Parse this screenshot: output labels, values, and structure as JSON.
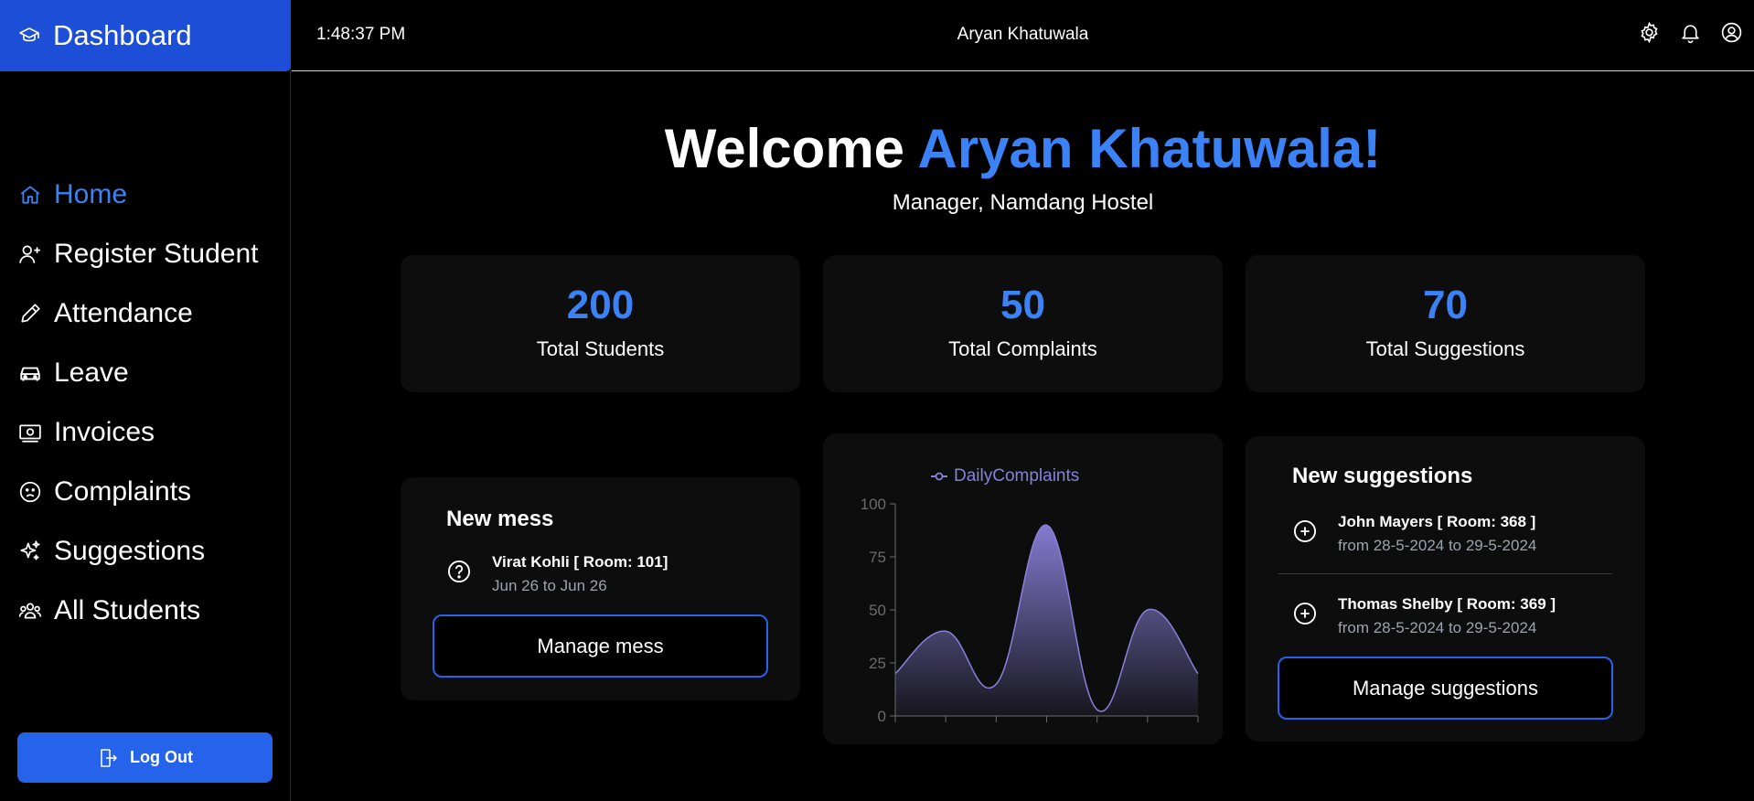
{
  "brand": {
    "title": "Dashboard"
  },
  "sidebar": {
    "items": [
      {
        "label": "Home",
        "icon": "home-icon",
        "active": true
      },
      {
        "label": "Register Student",
        "icon": "user-add-icon"
      },
      {
        "label": "Attendance",
        "icon": "pencil-icon"
      },
      {
        "label": "Leave",
        "icon": "car-icon"
      },
      {
        "label": "Invoices",
        "icon": "banknote-icon"
      },
      {
        "label": "Complaints",
        "icon": "sad-face-icon"
      },
      {
        "label": "Suggestions",
        "icon": "sparkles-icon"
      },
      {
        "label": "All Students",
        "icon": "users-icon"
      }
    ],
    "logout_label": "Log Out"
  },
  "topbar": {
    "time": "1:48:37 PM",
    "username": "Aryan Khatuwala",
    "icons": [
      "gear-icon",
      "bell-icon",
      "user-circle-icon"
    ]
  },
  "welcome": {
    "prefix": "Welcome ",
    "name": "Aryan Khatuwala!",
    "role": "Manager, Namdang Hostel"
  },
  "stats": [
    {
      "value": "200",
      "label": "Total Students"
    },
    {
      "value": "50",
      "label": "Total Complaints"
    },
    {
      "value": "70",
      "label": "Total Suggestions"
    }
  ],
  "mess": {
    "title": "New mess",
    "entries": [
      {
        "name": "Virat Kohli [ Room: 101]",
        "dates": "Jun 26 to Jun 26"
      }
    ],
    "button": "Manage mess"
  },
  "chart_data": {
    "type": "area",
    "series": [
      {
        "name": "DailyComplaints",
        "values": [
          20,
          40,
          15,
          90,
          3,
          50,
          20
        ]
      }
    ],
    "x": [
      0,
      1,
      2,
      3,
      4,
      5,
      6
    ],
    "ylim": [
      0,
      100
    ],
    "yticks": [
      "0",
      "25",
      "50",
      "75",
      "100"
    ],
    "grid": false,
    "legend": "top",
    "color": "#8b80d9"
  },
  "suggestions": {
    "title": "New suggestions",
    "entries": [
      {
        "name": "John Mayers [ Room: 368 ]",
        "dates": "from 28-5-2024 to 29-5-2024"
      },
      {
        "name": "Thomas Shelby [ Room: 369 ]",
        "dates": "from 28-5-2024 to 29-5-2024"
      }
    ],
    "button": "Manage suggestions"
  },
  "colors": {
    "accent": "#3b82f6",
    "brand": "#1d4ed8",
    "card": "#0d0d0d"
  }
}
